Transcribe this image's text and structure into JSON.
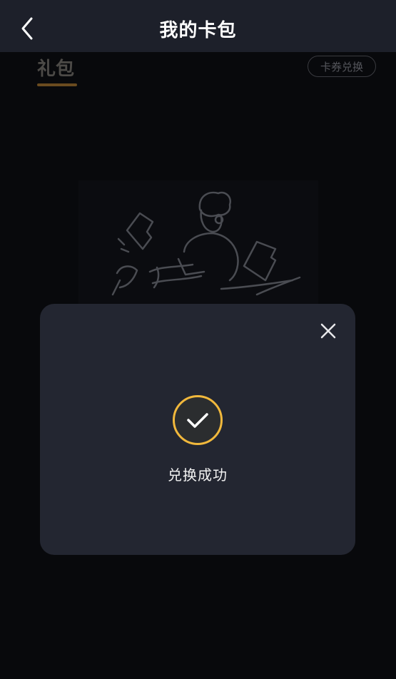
{
  "header": {
    "title": "我的卡包",
    "back_icon": "chevron-left-icon"
  },
  "tabs": [
    {
      "label": "礼包",
      "active": true
    }
  ],
  "redeem_button": {
    "label": "卡券兑换"
  },
  "modal": {
    "message": "兑换成功",
    "close_icon": "close-icon",
    "status_icon": "check-circle-icon",
    "accent_color": "#f1b83c"
  },
  "colors": {
    "background": "#08090c",
    "navbar": "#1d202a",
    "modal": "#232631",
    "tab_underline": "#6a4b1f"
  }
}
